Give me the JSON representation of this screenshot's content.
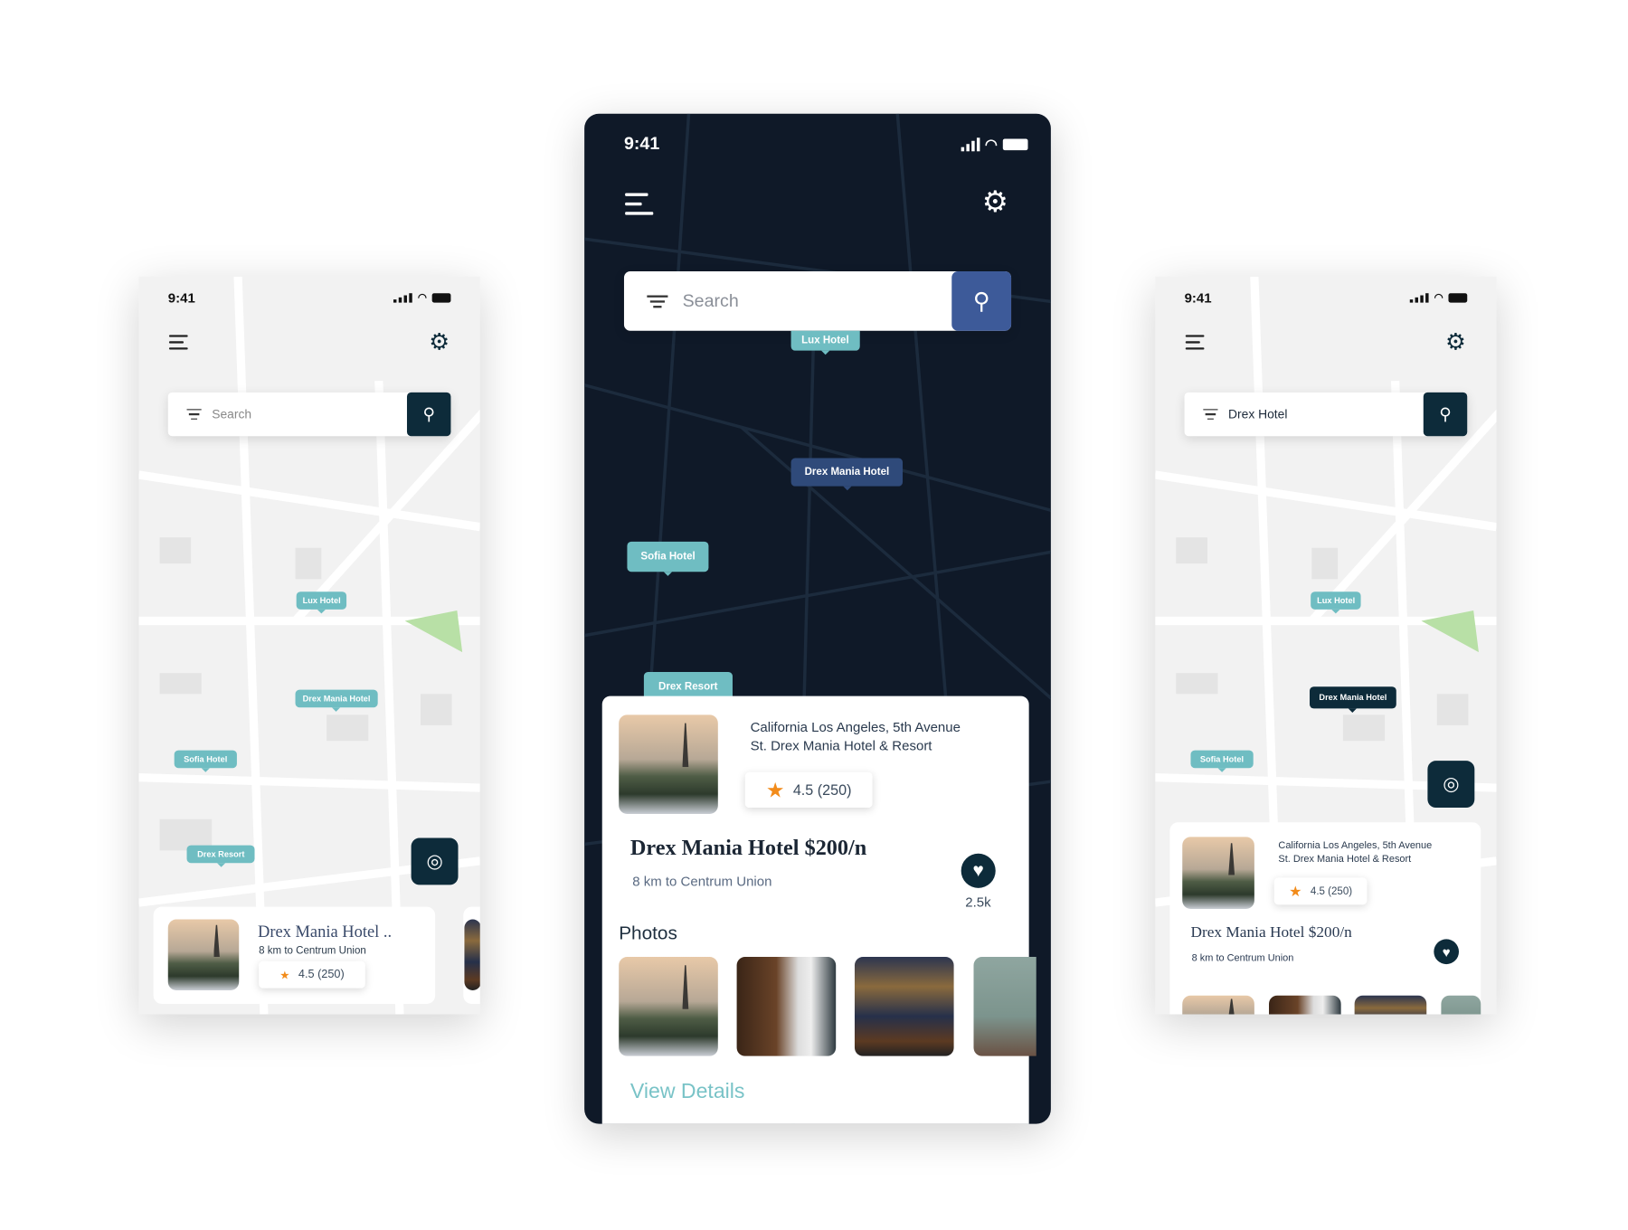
{
  "status": {
    "time": "9:41"
  },
  "left_phone": {
    "search": {
      "placeholder": "Search"
    },
    "markers": [
      "Lux Hotel",
      "Drex Mania Hotel",
      "Sofia Hotel",
      "Drex Resort"
    ],
    "card": {
      "title": "Drex Mania Hotel ..",
      "distance": "8 km to Centrum Union",
      "rating": "4.5 (250)"
    }
  },
  "center_phone": {
    "search": {
      "placeholder": "Search"
    },
    "markers": [
      "Lux Hotel",
      "Drex Mania Hotel",
      "Sofia Hotel",
      "Drex Resort"
    ],
    "card": {
      "address_line1": "California Los Angeles, 5th Avenue",
      "address_line2": "St. Drex Mania Hotel & Resort",
      "rating": "4.5 (250)",
      "title": "Drex Mania Hotel $200/n",
      "distance": "8 km to Centrum Union",
      "likes": "2.5k",
      "photos_label": "Photos",
      "view_details": "View Details"
    }
  },
  "right_phone": {
    "search": {
      "value": "Drex Hotel"
    },
    "markers": [
      "Lux Hotel",
      "Drex Mania Hotel",
      "Sofia Hotel"
    ],
    "card": {
      "address_line1": "California Los Angeles, 5th Avenue",
      "address_line2": "St. Drex Mania Hotel & Resort",
      "rating": "4.5 (250)",
      "title": "Drex Mania Hotel $200/n",
      "distance": "8 km to Centrum Union"
    }
  },
  "colors": {
    "dark_map": "#0f1928",
    "marker_teal": "#6fbdc2",
    "navy": "#0d2b3a",
    "search_blue": "#3d5a99",
    "star": "#f28b1a"
  },
  "icons": [
    "menu-icon",
    "gear-icon",
    "filter-icon",
    "search-icon",
    "locate-icon",
    "star-icon",
    "heart-icon",
    "signal-icon",
    "wifi-icon",
    "battery-icon"
  ]
}
